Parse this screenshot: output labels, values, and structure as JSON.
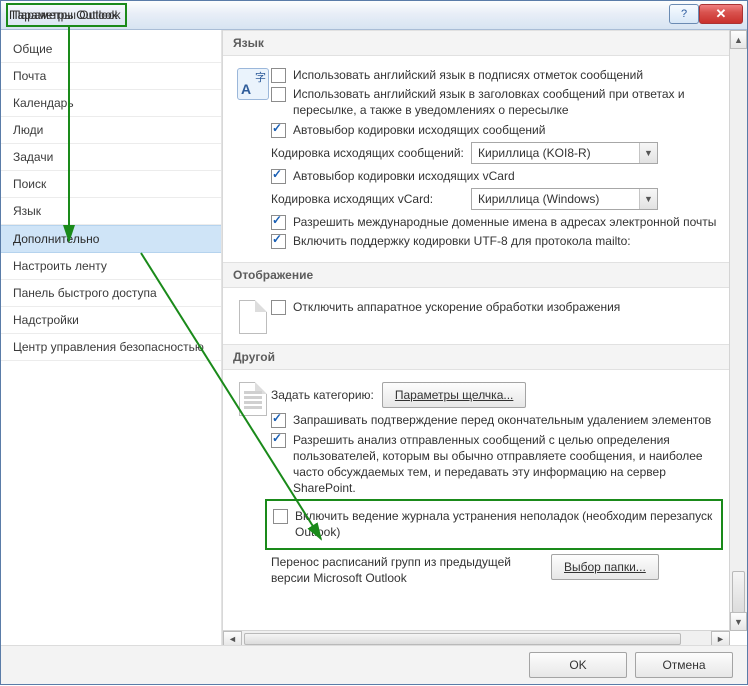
{
  "window": {
    "title": "Параметры Outlook"
  },
  "sidebar": {
    "items": [
      {
        "label": "Общие"
      },
      {
        "label": "Почта"
      },
      {
        "label": "Календарь"
      },
      {
        "label": "Люди"
      },
      {
        "label": "Задачи"
      },
      {
        "label": "Поиск"
      },
      {
        "label": "Язык"
      },
      {
        "label": "Дополнительно",
        "selected": true
      },
      {
        "label": "Настроить ленту"
      },
      {
        "label": "Панель быстрого доступа"
      },
      {
        "label": "Надстройки"
      },
      {
        "label": "Центр управления безопасностью"
      }
    ]
  },
  "sections": {
    "lang": {
      "header": "Язык",
      "chk_signatures": "Использовать английский язык в подписях отметок сообщений",
      "chk_replyheaders": "Использовать английский язык в заголовках сообщений при ответах и пересылке, а также в уведомлениях о пересылке",
      "chk_autoenc": "Автовыбор кодировки исходящих сообщений",
      "lbl_outenc": "Кодировка исходящих сообщений:",
      "val_outenc": "Кириллица (KOI8-R)",
      "chk_autovcard": "Автовыбор кодировки исходящих vCard",
      "lbl_vcardenc": "Кодировка исходящих vCard:",
      "val_vcardenc": "Кириллица (Windows)",
      "chk_idn": "Разрешить международные доменные имена в адресах электронной почты",
      "chk_utf8": "Включить поддержку кодировки UTF-8 для протокола mailto:"
    },
    "display": {
      "header": "Отображение",
      "chk_hwaccel": "Отключить аппаратное ускорение обработки изображения"
    },
    "other": {
      "header": "Другой",
      "lbl_setcat": "Задать категорию:",
      "btn_quick": "Параметры щелчка...",
      "chk_confirmdel": "Запрашивать подтверждение перед окончательным удалением элементов",
      "chk_sharepoint": "Разрешить анализ отправленных сообщений с целью определения пользователей, которым вы обычно отправляете сообщения, и наиболее часто обсуждаемых тем, и передавать эту информацию на сервер SharePoint.",
      "chk_logging": "Включить ведение журнала устранения неполадок (необходим перезапуск Outlook)",
      "lbl_migrate": "Перенос расписаний групп из предыдущей версии Microsoft Outlook",
      "btn_folder": "Выбор папки..."
    }
  },
  "footer": {
    "ok": "OK",
    "cancel": "Отмена"
  }
}
